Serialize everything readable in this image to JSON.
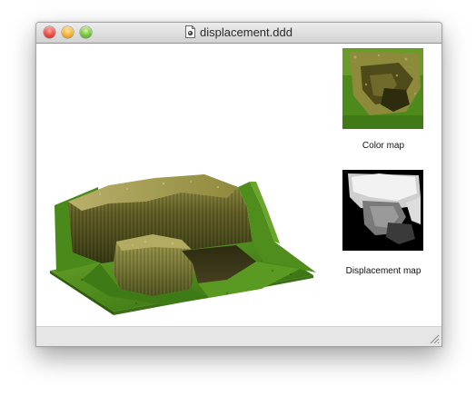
{
  "window": {
    "title": "displacement.ddd"
  },
  "icons": {
    "close": "close-button-red",
    "minimize": "minimize-button-yellow",
    "zoom": "zoom-button-green",
    "document": "document-file-icon",
    "resize": "resize-grip-icon"
  },
  "preview": {
    "description_name": "terrain-3d-render"
  },
  "thumbnails": {
    "color_map_label": "Color map",
    "displacement_map_label": "Displacement map"
  },
  "colors": {
    "titlebar_top": "#ececec",
    "titlebar_bottom": "#d3d3d3",
    "statusbar": "#e6e6e6",
    "terrain_green": "#4f8a1f",
    "rock_olive": "#6f6a2a"
  }
}
